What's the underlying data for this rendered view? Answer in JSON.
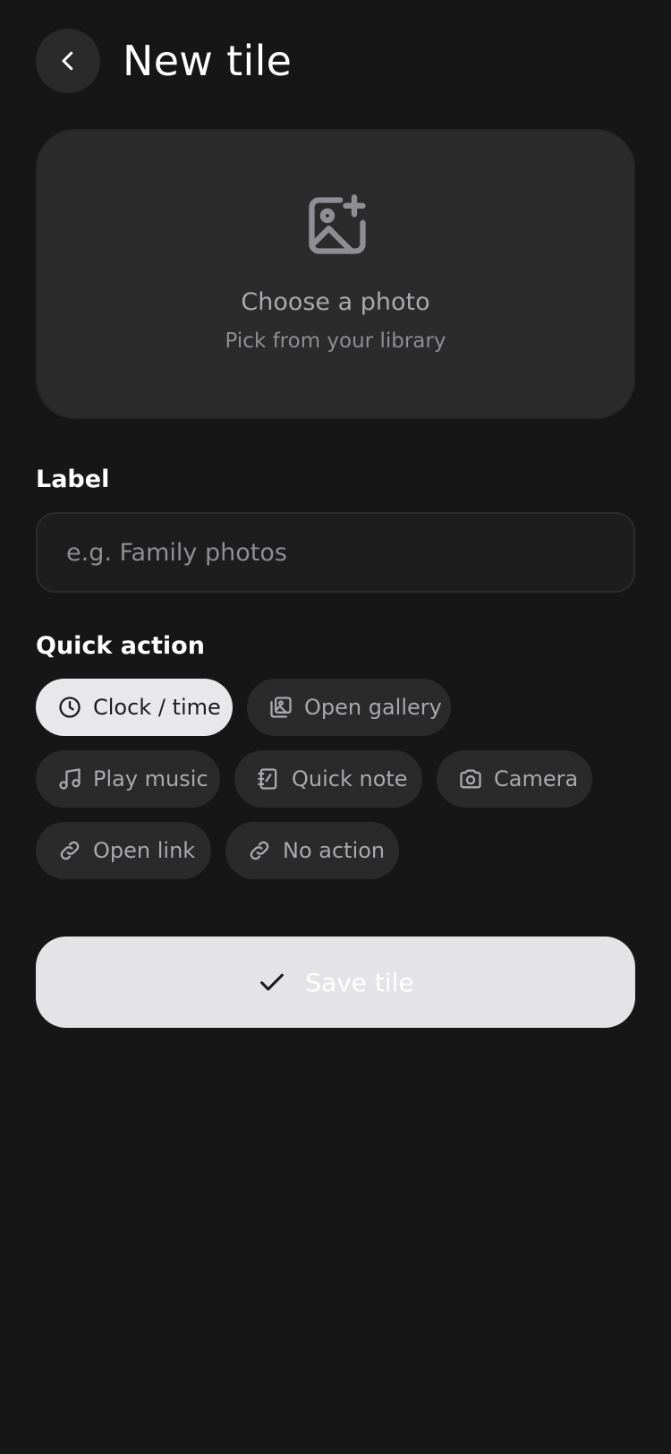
{
  "header": {
    "back_icon": "chevron-left-icon",
    "title": "New tile"
  },
  "photo_picker": {
    "icon": "image-plus-icon",
    "title": "Choose a photo",
    "subtitle": "Pick from your library"
  },
  "label_field": {
    "heading": "Label",
    "value": "",
    "placeholder": "e.g. Family photos"
  },
  "quick_action": {
    "heading": "Quick action",
    "selected": "Clock / time",
    "options": [
      {
        "label": "Clock / time",
        "icon": "clock-icon",
        "selected": true
      },
      {
        "label": "Open gallery",
        "icon": "gallery-icon",
        "selected": false
      },
      {
        "label": "Play music",
        "icon": "music-note-icon",
        "selected": false
      },
      {
        "label": "Quick note",
        "icon": "notebook-icon",
        "selected": false
      },
      {
        "label": "Camera",
        "icon": "camera-icon",
        "selected": false
      },
      {
        "label": "Open link",
        "icon": "link-icon",
        "selected": false
      },
      {
        "label": "No action",
        "icon": "link-icon",
        "selected": false
      }
    ]
  },
  "save_button": {
    "icon": "check-icon",
    "label": "Save tile"
  },
  "colors": {
    "background": "#161616",
    "card": "#2b2b2b",
    "chip": "#2a2a2a",
    "chip_selected": "#e8e8ea",
    "save_button": "#e4e4e6",
    "muted_text": "#a9a9ae"
  }
}
